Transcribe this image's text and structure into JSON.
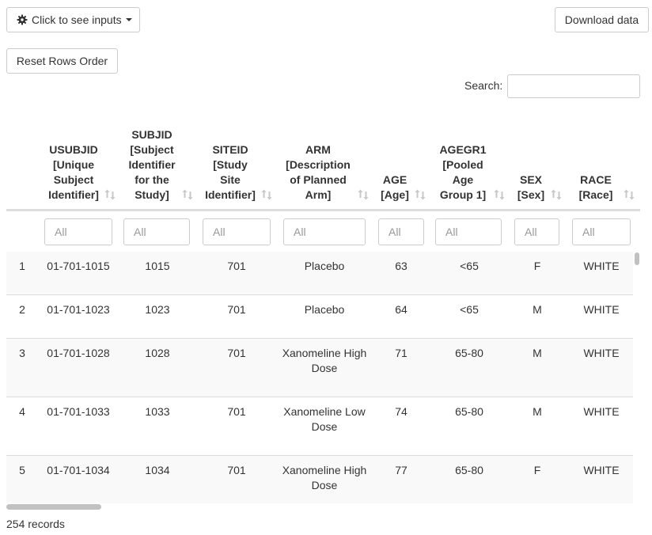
{
  "toolbar": {
    "inputs_label": "Click to see inputs",
    "download_label": "Download data",
    "reset_label": "Reset Rows Order",
    "icons": {
      "inputs": "gear-icon",
      "dropdown": "caret-down-icon",
      "sort": "sort-both-icon"
    }
  },
  "search": {
    "label": "Search:",
    "value": "",
    "placeholder": ""
  },
  "table": {
    "columns": [
      {
        "key": "row",
        "label": ""
      },
      {
        "key": "usubjid",
        "label": "USUBJID [Unique Subject Identifier]"
      },
      {
        "key": "subjid",
        "label": "SUBJID [Subject Identifier for the Study]"
      },
      {
        "key": "siteid",
        "label": "SITEID [Study Site Identifier]"
      },
      {
        "key": "arm",
        "label": "ARM [Description of Planned Arm]"
      },
      {
        "key": "age",
        "label": "AGE [Age]"
      },
      {
        "key": "agegr1",
        "label": "AGEGR1 [Pooled Age Group 1]"
      },
      {
        "key": "sex",
        "label": "SEX [Sex]"
      },
      {
        "key": "race",
        "label": "RACE [Race]"
      }
    ],
    "filter_placeholder": "All",
    "rows": [
      {
        "row": "1",
        "usubjid": "01-701-1015",
        "subjid": "1015",
        "siteid": "701",
        "arm": "Placebo",
        "age": "63",
        "agegr1": "<65",
        "sex": "F",
        "race": "WHITE"
      },
      {
        "row": "2",
        "usubjid": "01-701-1023",
        "subjid": "1023",
        "siteid": "701",
        "arm": "Placebo",
        "age": "64",
        "agegr1": "<65",
        "sex": "M",
        "race": "WHITE"
      },
      {
        "row": "3",
        "usubjid": "01-701-1028",
        "subjid": "1028",
        "siteid": "701",
        "arm": "Xanomeline High Dose",
        "age": "71",
        "agegr1": "65-80",
        "sex": "M",
        "race": "WHITE"
      },
      {
        "row": "4",
        "usubjid": "01-701-1033",
        "subjid": "1033",
        "siteid": "701",
        "arm": "Xanomeline Low Dose",
        "age": "74",
        "agegr1": "65-80",
        "sex": "M",
        "race": "WHITE"
      },
      {
        "row": "5",
        "usubjid": "01-701-1034",
        "subjid": "1034",
        "siteid": "701",
        "arm": "Xanomeline High Dose",
        "age": "77",
        "agegr1": "65-80",
        "sex": "F",
        "race": "WHITE"
      }
    ]
  },
  "footer": {
    "records": "254 records"
  }
}
